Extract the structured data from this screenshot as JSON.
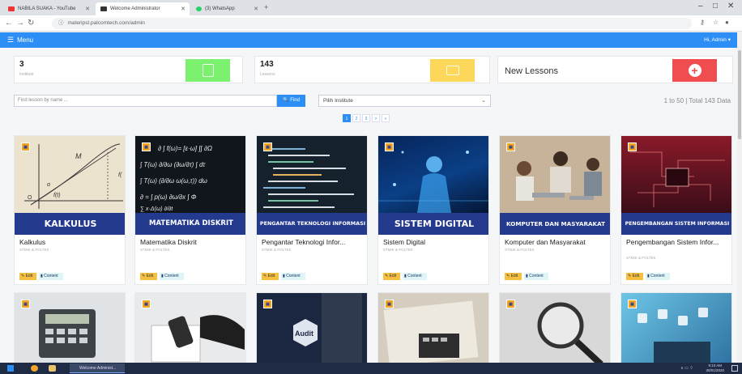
{
  "browser": {
    "tabs": [
      {
        "label": "NABILA SUAKA - YouTube",
        "favicon_color": "#e33"
      },
      {
        "label": "Welcome Administrator",
        "favicon_color": "#333"
      },
      {
        "label": "(3) WhatsApp",
        "favicon_color": "#25d366"
      }
    ],
    "url": "materipst.palcomtech.com/admin"
  },
  "header": {
    "menu_label": "Menu",
    "greeting": "Hi, Admin"
  },
  "stats": [
    {
      "value": "3",
      "label": "Institute",
      "color": "#7cf170"
    },
    {
      "value": "143",
      "label": "Lessons",
      "color": "#fcd75a"
    },
    {
      "value": "New Lessons",
      "color": "#ef4d4f"
    }
  ],
  "search": {
    "placeholder": "Find lesson by name ...",
    "button": "Find"
  },
  "institute_select": "Pilih Institute",
  "range_info": "1 to 50 | Total 143 Data",
  "pagination": [
    "1",
    "2",
    "3",
    ">",
    "»"
  ],
  "cards": [
    {
      "banner": "KALKULUS",
      "title": "Kalkulus",
      "sub": "STMIK & POLTEK",
      "image": "math-diagram"
    },
    {
      "banner": "MATEMATIKA DISKRIT",
      "title": "Matematika Diskrit",
      "sub": "STMIK & POLTEK",
      "image": "chalkboard-formulas"
    },
    {
      "banner": "PENGANTAR TEKNOLOGI INFORMASI",
      "title": "Pengantar Teknologi Infor...",
      "sub": "STMIK & POLTEK",
      "image": "code-screen"
    },
    {
      "banner": "SISTEM DIGITAL",
      "title": "Sistem Digital",
      "sub": "STMIK & POLTEK",
      "image": "digital-figure"
    },
    {
      "banner": "KOMPUTER DAN MASYARAKAT",
      "title": "Komputer dan Masyarakat",
      "sub": "STMIK & POLTEK",
      "image": "people-laptops"
    },
    {
      "banner": "PENGEMBANGAN SISTEM INFORMASI",
      "title": "Pengembangan Sistem Infor...",
      "sub": "STMIK & POLTEK",
      "image": "circuit-blue"
    }
  ],
  "card_buttons": {
    "edit": "Edit",
    "content": "Content"
  },
  "taskbar": {
    "app_label": "Welcome Administ...",
    "time": "9:10 AM",
    "date": "30/01/2020"
  }
}
